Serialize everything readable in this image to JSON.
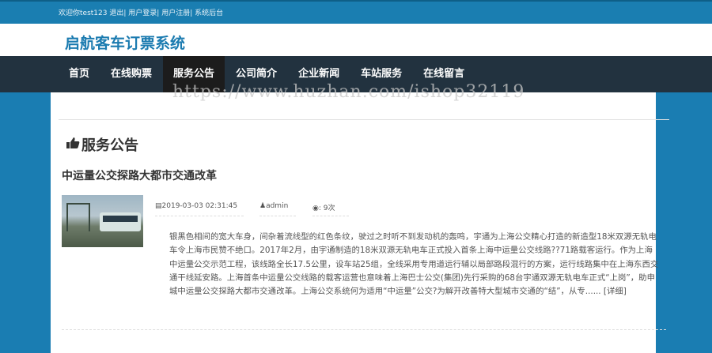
{
  "topbar": {
    "welcome": "欢迎你test123",
    "logout": "退出",
    "login": "用户登录",
    "register": "用户注册",
    "admin": "系统后台",
    "sep": "|"
  },
  "header": {
    "logo": "启航客车订票系统"
  },
  "nav": [
    {
      "label": "首页"
    },
    {
      "label": "在线购票"
    },
    {
      "label": "服务公告"
    },
    {
      "label": "公司简介"
    },
    {
      "label": "企业新闻"
    },
    {
      "label": "车站服务"
    },
    {
      "label": "在线留言"
    }
  ],
  "watermark": "https://www.huzhan.com/ishop32119",
  "section": {
    "title": "服务公告"
  },
  "article": {
    "title": "中运量公交探路大都市交通改革",
    "date": "2019-03-03 02:31:45",
    "author": "admin",
    "views": ": 9次",
    "summary": "银黑色相间的宽大车身，间杂着流线型的红色条纹，驶过之时听不到发动机的轰鸣，宇通为上海公交精心打造的新造型18米双源无轨电车令上海市民赞不绝口。2017年2月，由宇通制造的18米双源无轨电车正式投入首条上海中运量公交线路??71路载客运行。作为上海中运量公交示范工程，该线路全长17.5公里，设车站25组，全线采用专用道运行辅以局部路段混行的方案，运行线路集中在上海东西交通干线延安路。上海首条中运量公交线路的载客运营也意味着上海巴士公交(集团)先行采购的68台宇通双源无轨电车正式“上岗”，助申城中运量公交探路大都市交通改革。上海公交系统何为适用“中运量”公交?为解开改善特大型城市交通的“结”，从专......",
    "more": "[详细]"
  }
}
